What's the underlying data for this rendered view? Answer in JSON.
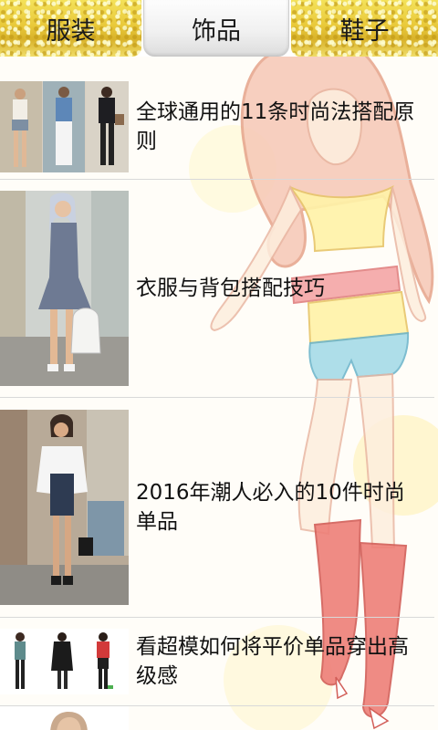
{
  "tabs": [
    {
      "label": "服装",
      "active": false
    },
    {
      "label": "饰品",
      "active": true
    },
    {
      "label": "鞋子",
      "active": false
    }
  ],
  "articles": [
    {
      "title": "全球通用的11条时尚法搭配原则",
      "thumb": "three-women-street-outfits-image"
    },
    {
      "title": "衣服与背包搭配技巧",
      "thumb": "woman-grey-dress-white-backpack-image"
    },
    {
      "title": "2016年潮人必入的10件时尚单品",
      "thumb": "woman-white-blouse-denim-skirt-image"
    },
    {
      "title": "看超模如何将平价单品穿出高级感",
      "thumb": "three-models-full-body-image"
    },
    {
      "title": "",
      "thumb": "partial-woman-portrait-image"
    }
  ],
  "colors": {
    "tab_gold": "#e9c93a",
    "tab_active": "#efefef",
    "divider": "#d9d9d9",
    "illustration_hair": "#f0b8a0",
    "illustration_top": "#fff1a0",
    "illustration_shorts": "#9fd6e6",
    "illustration_boots": "#e8706a"
  }
}
